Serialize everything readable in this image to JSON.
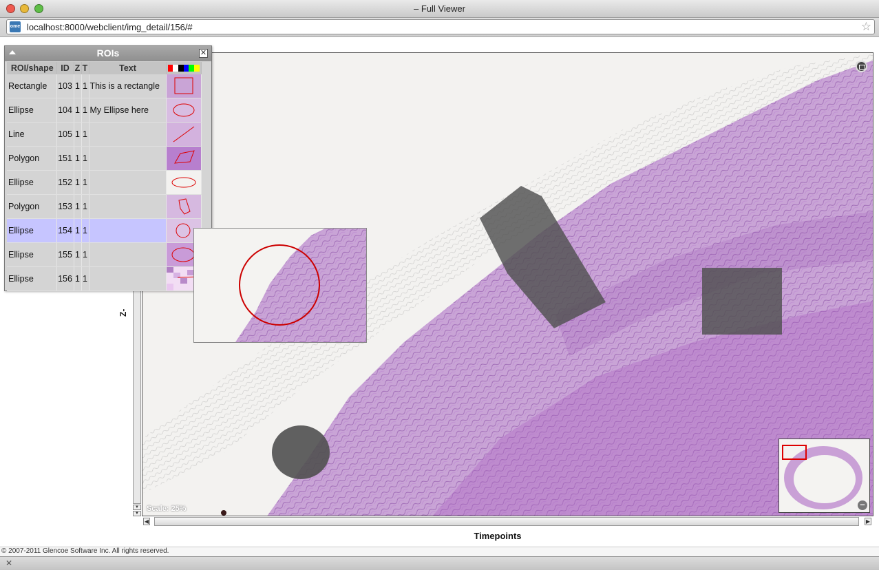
{
  "window": {
    "title": "– Full Viewer"
  },
  "address_bar": {
    "url": "localhost:8000/webclient/img_detail/156/#",
    "favicon_text": "ome"
  },
  "viewer": {
    "scale_text": "Scale: 25%",
    "z_label": "Z-section",
    "t_label": "Timepoints"
  },
  "roi_panel": {
    "title": "ROIs",
    "columns": [
      "ROI/shape",
      "ID",
      "Z",
      "T",
      "Text"
    ],
    "color_swatches": [
      "#ff0000",
      "#ffffff",
      "#000000",
      "#0000ff",
      "#00ff00",
      "#ffff00"
    ],
    "rows": [
      {
        "shape": "Rectangle",
        "id": "103",
        "z": "1",
        "t": "1",
        "text": "This is a rectangle",
        "selected": false
      },
      {
        "shape": "Ellipse",
        "id": "104",
        "z": "1",
        "t": "1",
        "text": "My Ellipse here",
        "selected": false
      },
      {
        "shape": "Line",
        "id": "105",
        "z": "1",
        "t": "1",
        "text": "",
        "selected": false
      },
      {
        "shape": "Polygon",
        "id": "151",
        "z": "1",
        "t": "1",
        "text": "",
        "selected": false
      },
      {
        "shape": "Ellipse",
        "id": "152",
        "z": "1",
        "t": "1",
        "text": "",
        "selected": false
      },
      {
        "shape": "Polygon",
        "id": "153",
        "z": "1",
        "t": "1",
        "text": "",
        "selected": false
      },
      {
        "shape": "Ellipse",
        "id": "154",
        "z": "1",
        "t": "1",
        "text": "",
        "selected": true
      },
      {
        "shape": "Ellipse",
        "id": "155",
        "z": "1",
        "t": "1",
        "text": "",
        "selected": false
      },
      {
        "shape": "Ellipse",
        "id": "156",
        "z": "1",
        "t": "1",
        "text": "",
        "selected": false
      }
    ]
  },
  "footer": {
    "copyright": "© 2007-2011 Glencoe Software Inc. All rights reserved."
  },
  "colors": {
    "tissue": "#9b4fb3",
    "roi_overlay": "#505050",
    "roi_stroke": "#cc0000",
    "selected_row": "#c6c5ff"
  },
  "icons": {
    "fullscreen": "monitor-icon",
    "zoom_out": "minus-icon",
    "bookmark": "star-icon",
    "close": "close-icon"
  }
}
